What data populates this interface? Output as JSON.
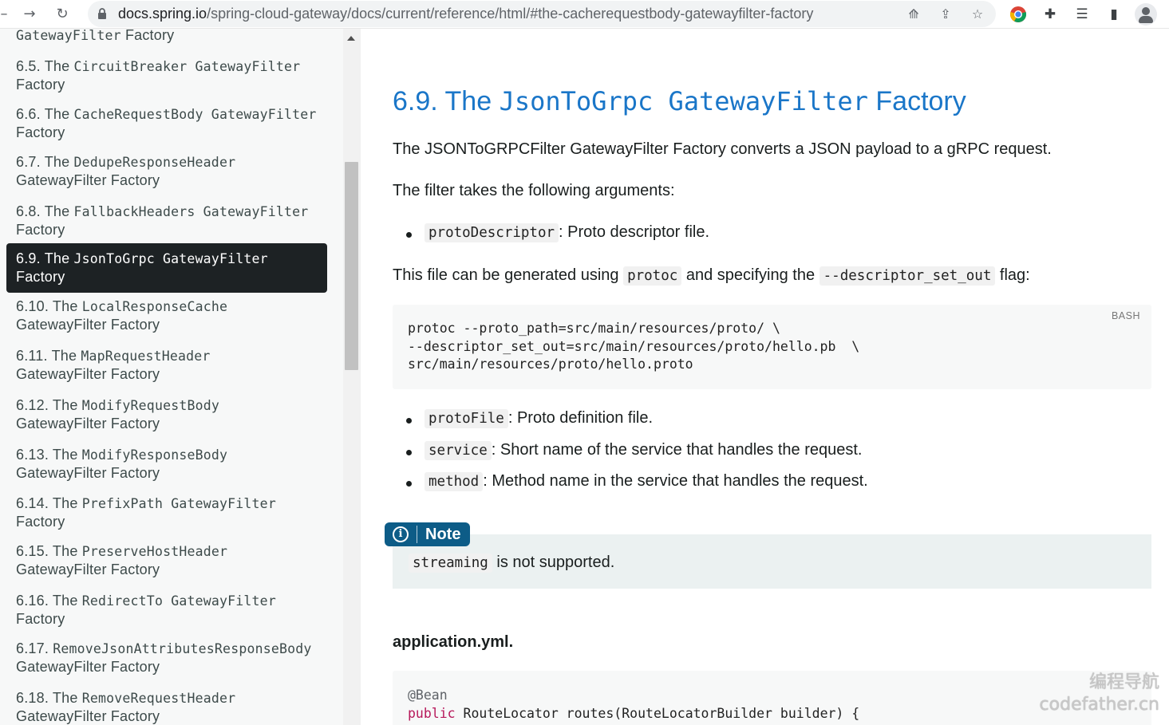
{
  "browser": {
    "url_host": "docs.spring.io",
    "url_path": "/spring-cloud-gateway/docs/current/reference/html/#the-cacherequestbody-gatewayfilter-factory"
  },
  "sidebar": {
    "items": [
      {
        "label_prefix": "",
        "mono": "GatewayFilter",
        "label_suffix": " Factory"
      },
      {
        "label_prefix": "6.5. The ",
        "mono": "CircuitBreaker GatewayFilter",
        "label_suffix": "Factory"
      },
      {
        "label_prefix": "6.6. The ",
        "mono": "CacheRequestBody GatewayFilter",
        "label_suffix": "Factory"
      },
      {
        "label_prefix": "6.7. The ",
        "mono": "DedupeResponseHeader",
        "label_suffix": "GatewayFilter Factory"
      },
      {
        "label_prefix": "6.8. The ",
        "mono": "FallbackHeaders GatewayFilter",
        "label_suffix": "Factory"
      },
      {
        "label_prefix": "6.9. The ",
        "mono": "JsonToGrpc GatewayFilter",
        "label_suffix": "Factory"
      },
      {
        "label_prefix": "6.10. The ",
        "mono": "LocalResponseCache",
        "label_suffix": "GatewayFilter Factory"
      },
      {
        "label_prefix": "6.11. The ",
        "mono": "MapRequestHeader",
        "label_suffix": "GatewayFilter Factory"
      },
      {
        "label_prefix": "6.12. The ",
        "mono": "ModifyRequestBody",
        "label_suffix": "GatewayFilter Factory"
      },
      {
        "label_prefix": "6.13. The ",
        "mono": "ModifyResponseBody",
        "label_suffix": "GatewayFilter Factory"
      },
      {
        "label_prefix": "6.14. The ",
        "mono": "PrefixPath GatewayFilter",
        "label_suffix": "Factory"
      },
      {
        "label_prefix": "6.15. The ",
        "mono": "PreserveHostHeader",
        "label_suffix": "GatewayFilter Factory"
      },
      {
        "label_prefix": "6.16. The ",
        "mono": "RedirectTo GatewayFilter",
        "label_suffix": "Factory"
      },
      {
        "label_prefix": "6.17. ",
        "mono": "RemoveJsonAttributesResponseBody",
        "label_suffix": "GatewayFilter Factory"
      },
      {
        "label_prefix": "6.18. The ",
        "mono": "RemoveRequestHeader",
        "label_suffix": "GatewayFilter Factory"
      }
    ]
  },
  "main": {
    "heading": {
      "prefix": "6.9. The ",
      "mono": "JsonToGrpc GatewayFilter",
      "suffix": " Factory"
    },
    "intro": "The JSONToGRPCFilter GatewayFilter Factory converts a JSON payload to a gRPC request.",
    "args_intro": "The filter takes the following arguments:",
    "arg1": {
      "code": "protoDescriptor",
      "text": ": Proto descriptor file."
    },
    "gen": {
      "part1": "This file can be generated using ",
      "code1": "protoc",
      "part2": " and specifying the ",
      "code2": "--descriptor_set_out",
      "part3": " flag:"
    },
    "code1": {
      "lang": "BASH",
      "text": "protoc --proto_path=src/main/resources/proto/ \\\n--descriptor_set_out=src/main/resources/proto/hello.pb  \\\nsrc/main/resources/proto/hello.proto"
    },
    "arg2": {
      "code": "protoFile",
      "text": ": Proto definition file."
    },
    "arg3": {
      "code": "service",
      "text": ": Short name of the service that handles the request."
    },
    "arg4": {
      "code": "method",
      "text": ": Method name in the service that handles the request."
    },
    "note": {
      "label": "Note",
      "code": "streaming",
      "text": " is not supported."
    },
    "subtitle": "application.yml.",
    "code2": {
      "line1": "@Bean",
      "kw": "public",
      "rest": " RouteLocator routes(RouteLocatorBuilder builder) {"
    }
  },
  "watermark": {
    "line1": "编程导航",
    "line2": "codefather.cn"
  },
  "colors": {
    "heading": "#1a76c8",
    "active_bg": "#1d2224",
    "note_badge": "#0d5c87",
    "keyword": "#b7195b"
  }
}
